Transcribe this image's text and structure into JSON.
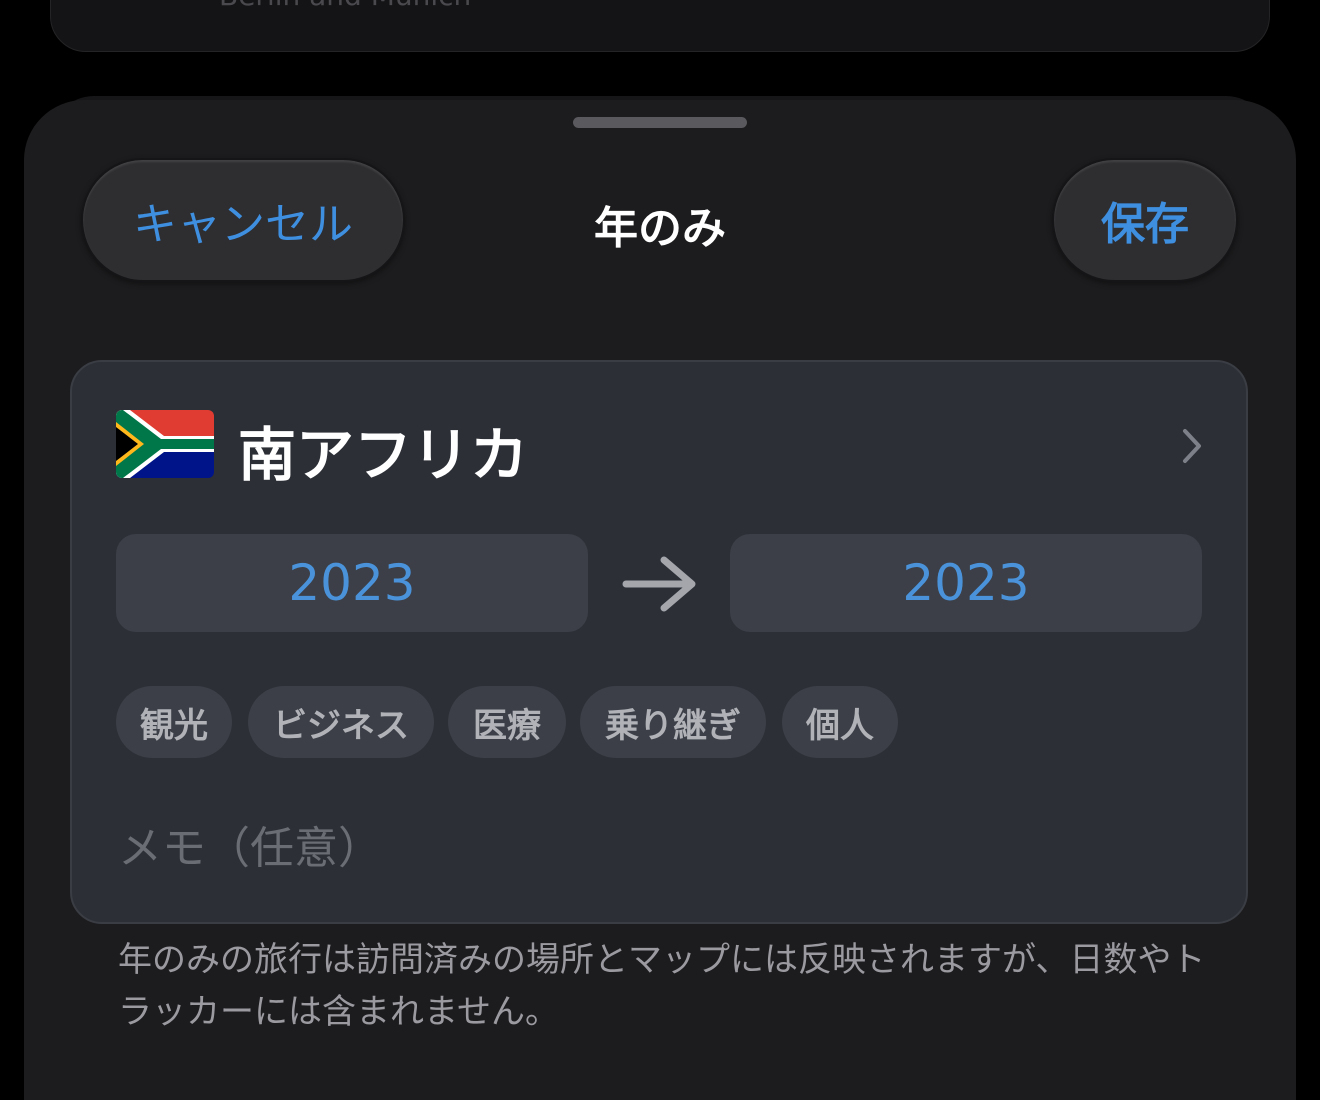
{
  "background_card": {
    "text": "Berlin and Munich"
  },
  "header": {
    "cancel_label": "キャンセル",
    "title": "年のみ",
    "save_label": "保存"
  },
  "entry": {
    "country_name": "南アフリカ",
    "flag_icon": "south-africa-flag",
    "start_year": "2023",
    "end_year": "2023",
    "tags": [
      "観光",
      "ビジネス",
      "医療",
      "乗り継ぎ",
      "個人"
    ],
    "memo_placeholder": "メモ（任意）"
  },
  "footer_note": "年のみの旅行は訪問済みの場所とマップには反映されますが、日数やトラッカーには含まれません。",
  "colors": {
    "accent": "#3f8fe0",
    "year_text": "#4a93da",
    "sheet_bg": "#1c1c1e",
    "card_bg": "#2c2f36"
  }
}
